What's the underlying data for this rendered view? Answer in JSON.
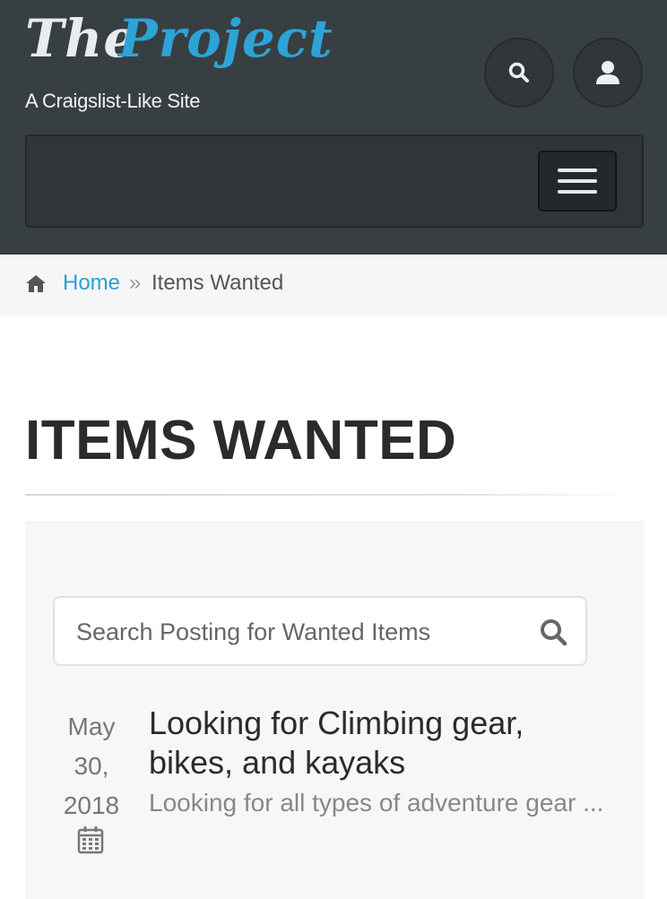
{
  "header": {
    "logo_the": "The",
    "logo_project": "Project",
    "tagline": "A Craigslist-Like Site"
  },
  "breadcrumb": {
    "home": "Home",
    "separator": "»",
    "current": "Items Wanted"
  },
  "page": {
    "title": "ITEMS WANTED"
  },
  "search": {
    "placeholder": "Search Posting for Wanted Items",
    "value": ""
  },
  "posts": [
    {
      "date_month": "May",
      "date_day": "30,",
      "date_year": "2018",
      "title": "Looking for Climbing gear, bikes, and kayaks",
      "excerpt": "Looking for all types of adventure gear ..."
    }
  ],
  "colors": {
    "header_bg": "#373f42",
    "accent": "#2da3d6",
    "panel_bg": "#f7f7f7"
  },
  "icons": [
    "search-icon",
    "user-icon",
    "menu-icon",
    "home-icon",
    "calendar-icon"
  ]
}
